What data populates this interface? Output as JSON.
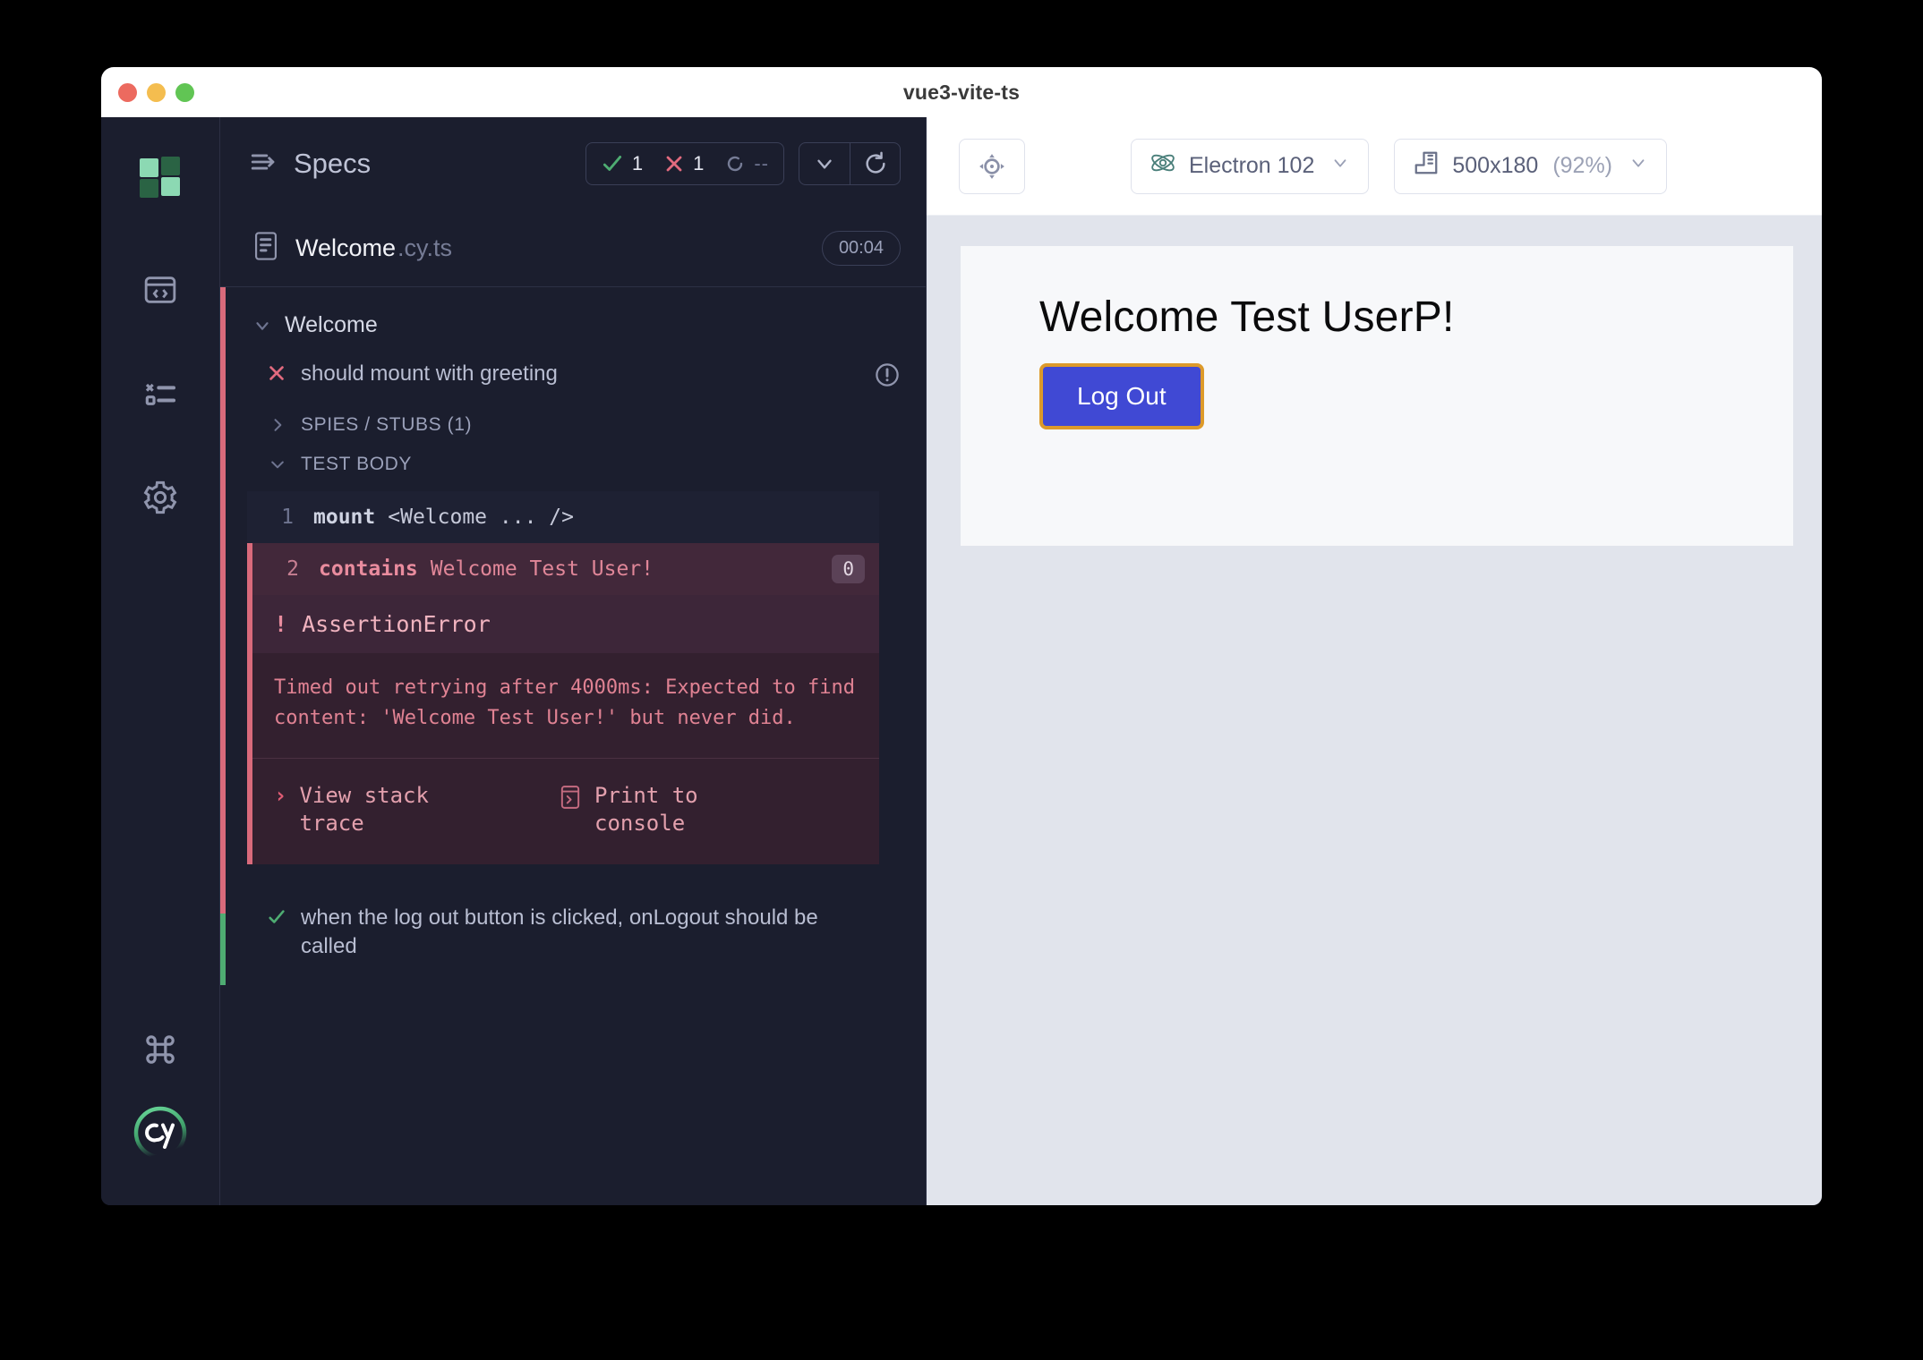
{
  "window": {
    "title": "vue3-vite-ts",
    "traffic_lights": [
      "close",
      "minimize",
      "zoom"
    ]
  },
  "rail": {
    "logo": "cypress-squares-logo",
    "items": [
      {
        "name": "specs",
        "icon": "code-window-icon"
      },
      {
        "name": "runs",
        "icon": "test-list-icon"
      },
      {
        "name": "settings",
        "icon": "gear-icon"
      }
    ],
    "bottom_items": [
      {
        "name": "keyboard-shortcuts",
        "icon": "command-key-icon"
      },
      {
        "name": "cypress-logo",
        "icon": "cy-logo"
      }
    ]
  },
  "reporter": {
    "header": {
      "icon": "specs-arrow-icon",
      "title": "Specs",
      "stats": {
        "passed": "1",
        "failed": "1",
        "pending": "--"
      },
      "controls": [
        {
          "name": "collapse-toggle",
          "icon": "chevron-down-icon"
        },
        {
          "name": "rerun-button",
          "icon": "reload-icon"
        }
      ]
    },
    "spec_file": {
      "icon": "file-icon",
      "name": "Welcome",
      "extension": ".cy.ts",
      "duration": "00:04"
    },
    "suite": {
      "label": "Welcome",
      "expanded": true
    },
    "failed_test": {
      "label": "should mount with greeting",
      "status": "failed",
      "warning_icon": "circle-exclamation-icon",
      "spies_stubs": "SPIES / STUBS (1)",
      "test_body_label": "TEST BODY",
      "commands": [
        {
          "num": "1",
          "name": "mount",
          "args": "<Welcome ... />",
          "state": "normal",
          "badge": ""
        },
        {
          "num": "2",
          "name": "contains",
          "args": "Welcome Test User!",
          "state": "failed",
          "badge": "0"
        }
      ],
      "error": {
        "type": "AssertionError",
        "message": "Timed out retrying after 4000ms: Expected to find content: 'Welcome Test User!' but never did.",
        "actions": [
          {
            "label": "View stack trace",
            "icon": "chevron-right-icon"
          },
          {
            "label": "Print to console",
            "icon": "console-icon"
          }
        ]
      }
    },
    "passed_test": {
      "label": "when the log out button is clicked, onLogout should be called",
      "status": "passed"
    }
  },
  "preview": {
    "toolbar": {
      "selector_playground": {
        "name": "selector-playground",
        "icon": "crosshair-icon"
      },
      "browser": {
        "icon": "electron-icon",
        "label": "Electron 102",
        "chevron": "chevron-down-icon"
      },
      "viewport": {
        "icon": "ruler-icon",
        "size": "500x180",
        "scale": "(92%)",
        "chevron": "chevron-down-icon"
      }
    },
    "app": {
      "heading": "Welcome Test UserP!",
      "button_label": "Log Out"
    }
  },
  "colors": {
    "bg_dark": "#1b1e2e",
    "fail_red": "#d96a7b",
    "pass_green": "#4eac72",
    "accent_blue": "#4049d4",
    "focus_gold": "#dd9a2a"
  }
}
